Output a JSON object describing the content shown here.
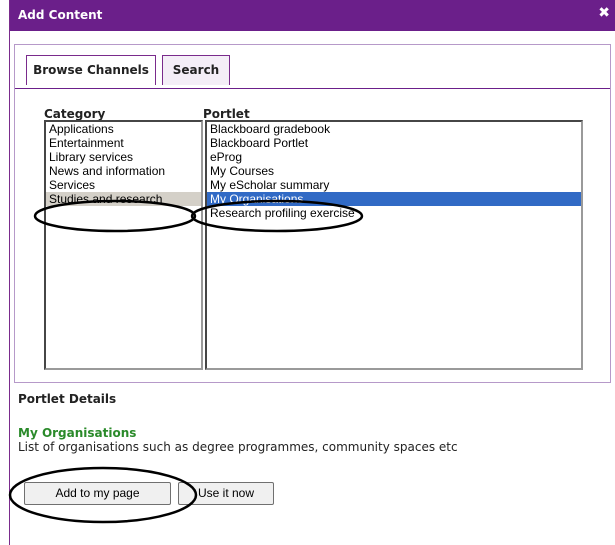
{
  "dialog": {
    "title": "Add Content",
    "close_icon": "close-icon"
  },
  "tabs": [
    {
      "label": "Browse Channels",
      "active": true
    },
    {
      "label": "Search",
      "active": false
    }
  ],
  "category": {
    "label": "Category",
    "items": [
      "Applications",
      "Entertainment",
      "Library services",
      "News and information",
      "Services",
      "Studies and research"
    ],
    "selected": "Studies and research"
  },
  "portlet": {
    "label": "Portlet",
    "items": [
      "Blackboard gradebook",
      "Blackboard Portlet",
      "eProg",
      "My Courses",
      "My eScholar summary",
      "My Organisations",
      "Research profiling exercise"
    ],
    "selected": "My Organisations"
  },
  "details": {
    "heading": "Portlet Details",
    "name": "My Organisations",
    "description": "List of organisations such as degree programmes, community spaces etc"
  },
  "buttons": {
    "add": "Add to my page",
    "use": "Use it now"
  },
  "colors": {
    "titlebar": "#6b1f8a",
    "selection": "#316ac5",
    "portlet_name": "#2a8a2a"
  }
}
